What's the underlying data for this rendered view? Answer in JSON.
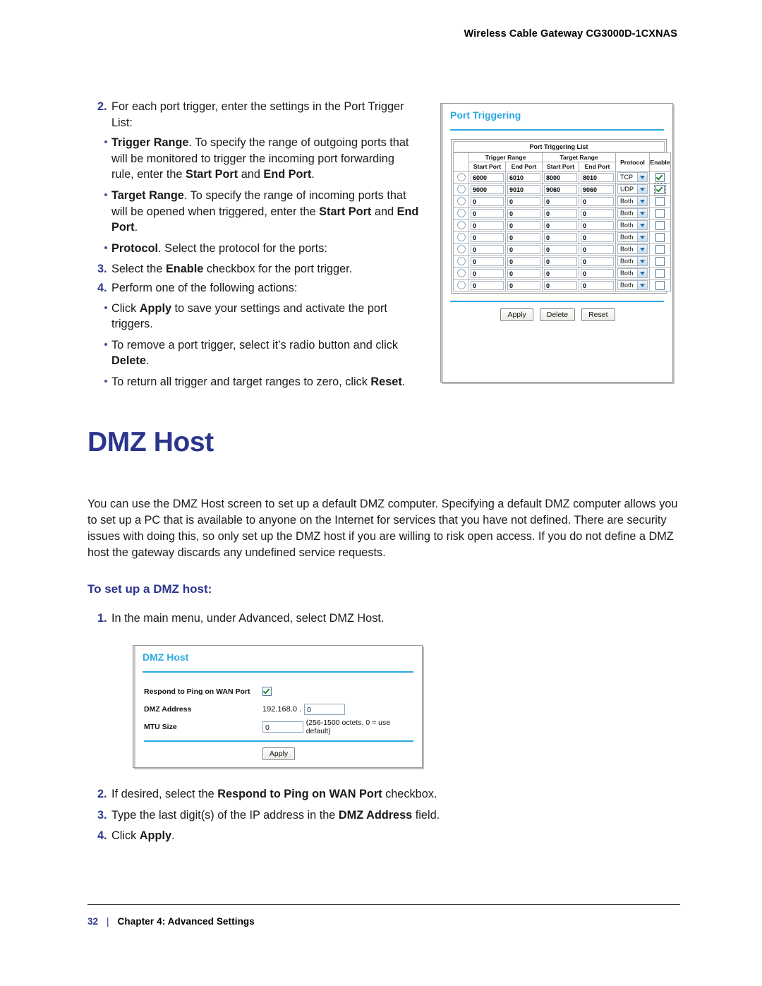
{
  "running_header": "Wireless Cable Gateway CG3000D-1CXNAS",
  "port_trigger_section": {
    "step2": {
      "num": "2.",
      "text_before": "For each port trigger, enter the settings in the Port Trigger List:"
    },
    "bullets": [
      {
        "bullet": "•",
        "term": "Trigger Range",
        "text": ". To specify the range of outgoing ports that will be monitored to trigger the incoming port forwarding rule, enter the ",
        "bold_a": "Start Port",
        "mid": " and ",
        "bold_b": "End Port",
        "tail": "."
      },
      {
        "bullet": "•",
        "term": "Target Range",
        "text": ". To specify the range of incoming ports that will be opened when triggered, enter the ",
        "bold_a": "Start Port",
        "mid": " and ",
        "bold_b": "End Port",
        "tail": "."
      },
      {
        "bullet": "•",
        "term": "Protocol",
        "text": ". Select the protocol for the ports:",
        "bold_a": "",
        "mid": "",
        "bold_b": "",
        "tail": ""
      }
    ],
    "step3": {
      "num": "3.",
      "pre": "Select the ",
      "bold": "Enable",
      "post": " checkbox for the port trigger."
    },
    "step4": {
      "num": "4.",
      "text": "Perform one of the following actions:"
    },
    "step4_bullets": [
      {
        "bullet": "•",
        "pre": "Click ",
        "bold": "Apply",
        "post": " to save your settings and activate the port triggers."
      },
      {
        "bullet": "•",
        "pre": "To remove a port trigger, select it’s radio button and click ",
        "bold": "Delete",
        "post": "."
      },
      {
        "bullet": "•",
        "pre": "To return all trigger and target ranges to zero, click ",
        "bold": "Reset",
        "post": "."
      }
    ]
  },
  "port_triggering_ui": {
    "title": "Port Triggering",
    "list_caption": "Port Triggering List",
    "group_headers": {
      "trigger": "Trigger Range",
      "target": "Target Range",
      "protocol": "Protocol",
      "enable": "Enable"
    },
    "sub_headers": {
      "start": "Start Port",
      "end": "End Port"
    },
    "rows": [
      {
        "trigger_start": "6000",
        "trigger_end": "6010",
        "target_start": "8000",
        "target_end": "8010",
        "protocol": "TCP",
        "enabled": true,
        "focus": false
      },
      {
        "trigger_start": "9000",
        "trigger_end": "9010",
        "target_start": "9060",
        "target_end": "9060",
        "protocol": "UDP",
        "enabled": true,
        "focus": true
      },
      {
        "trigger_start": "0",
        "trigger_end": "0",
        "target_start": "0",
        "target_end": "0",
        "protocol": "Both",
        "enabled": false,
        "focus": false
      },
      {
        "trigger_start": "0",
        "trigger_end": "0",
        "target_start": "0",
        "target_end": "0",
        "protocol": "Both",
        "enabled": false,
        "focus": false
      },
      {
        "trigger_start": "0",
        "trigger_end": "0",
        "target_start": "0",
        "target_end": "0",
        "protocol": "Both",
        "enabled": false,
        "focus": false
      },
      {
        "trigger_start": "0",
        "trigger_end": "0",
        "target_start": "0",
        "target_end": "0",
        "protocol": "Both",
        "enabled": false,
        "focus": false
      },
      {
        "trigger_start": "0",
        "trigger_end": "0",
        "target_start": "0",
        "target_end": "0",
        "protocol": "Both",
        "enabled": false,
        "focus": false
      },
      {
        "trigger_start": "0",
        "trigger_end": "0",
        "target_start": "0",
        "target_end": "0",
        "protocol": "Both",
        "enabled": false,
        "focus": false
      },
      {
        "trigger_start": "0",
        "trigger_end": "0",
        "target_start": "0",
        "target_end": "0",
        "protocol": "Both",
        "enabled": false,
        "focus": false
      },
      {
        "trigger_start": "0",
        "trigger_end": "0",
        "target_start": "0",
        "target_end": "0",
        "protocol": "Both",
        "enabled": false,
        "focus": false
      }
    ],
    "buttons": {
      "apply": "Apply",
      "delete": "Delete",
      "reset": "Reset"
    },
    "accent_color": "#2aa9e0"
  },
  "dmz_section": {
    "heading": "DMZ Host",
    "paragraph": "You can use the DMZ Host screen to set up a default DMZ computer. Specifying a default DMZ computer allows you to set up a PC that is available to anyone on the Internet for services that you have not defined. There are security issues with doing this, so only set up the DMZ host if you are willing to risk open access. If you do not define a DMZ host the gateway discards any undefined service requests.",
    "subheading": "To set up a DMZ host:",
    "steps": [
      {
        "num": "1.",
        "pre": "In the main menu, under Advanced, select DMZ Host.",
        "bold": "",
        "post": ""
      },
      {
        "num": "2.",
        "pre": "If desired, select the ",
        "bold": "Respond to Ping on WAN Port",
        "post": " checkbox."
      },
      {
        "num": "3.",
        "pre": "Type the last digit(s) of the IP address in the ",
        "bold": "DMZ Address",
        "post": " field."
      },
      {
        "num": "4.",
        "pre": "Click ",
        "bold": "Apply",
        "post": "."
      }
    ]
  },
  "dmz_ui": {
    "title": "DMZ Host",
    "ping_label": "Respond to Ping on WAN Port",
    "ping_checked": true,
    "address_label": "DMZ Address",
    "address_prefix": "192.168.0 .",
    "address_value": "0",
    "mtu_label": "MTU Size",
    "mtu_value": "0",
    "mtu_note": "(256-1500 octets, 0 = use default)",
    "apply_label": "Apply",
    "accent_color": "#2aa9e0"
  },
  "footer": {
    "page": "32",
    "separator": "|",
    "chapter": "Chapter 4:  Advanced Settings"
  }
}
